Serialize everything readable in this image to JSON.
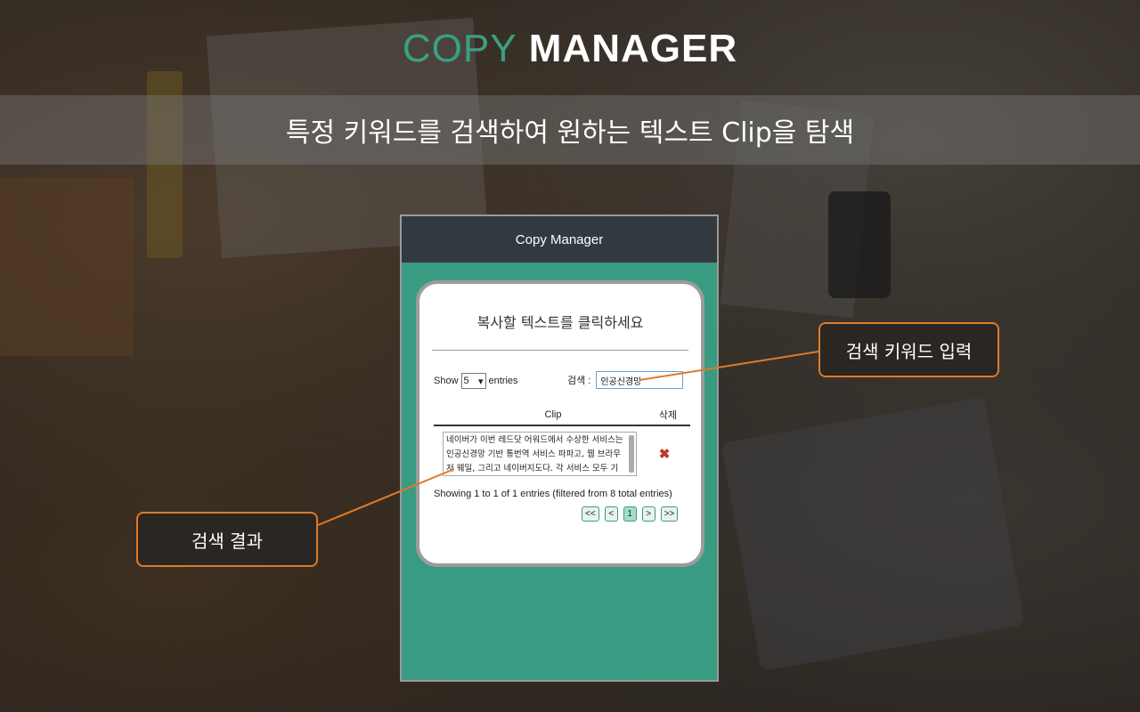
{
  "brand": {
    "part1": "COPY",
    "part2": "MANAGER"
  },
  "banner": {
    "text": "특정 키워드를 검색하여 원하는 텍스트 Clip을 탐색"
  },
  "app": {
    "title": "Copy Manager",
    "card_title": "복사할 텍스트를 클릭하세요",
    "show_label": "Show",
    "entries_value": "5",
    "entries_label": "entries",
    "search_label": "검색 :",
    "search_value": "인공신경망",
    "table": {
      "col_clip": "Clip",
      "col_delete": "삭제",
      "rows": [
        {
          "clip": "네이버가 이번 레드닷 어워드에서 수상한 서비스는 인공신경망 기반 통번역 서비스 파파고, 웹 브라우저 웨일, 그리고 네이버지도다. 각 서비스 모두 기능과 디자인"
        }
      ]
    },
    "info": "Showing 1 to 1 of 1 entries (filtered from 8 total entries)",
    "pager": {
      "first": "<<",
      "prev": "<",
      "current": "1",
      "next": ">",
      "last": ">>"
    }
  },
  "callouts": {
    "keyword": "검색 키워드 입력",
    "result": "검색 결과"
  },
  "colors": {
    "accent": "#3aa082",
    "callout_border": "#e07a26",
    "frame_green": "#3a9b83",
    "delete_red": "#c0392b"
  },
  "icons": {
    "delete": "close-x-icon",
    "dropdown": "chevron-down-icon"
  }
}
